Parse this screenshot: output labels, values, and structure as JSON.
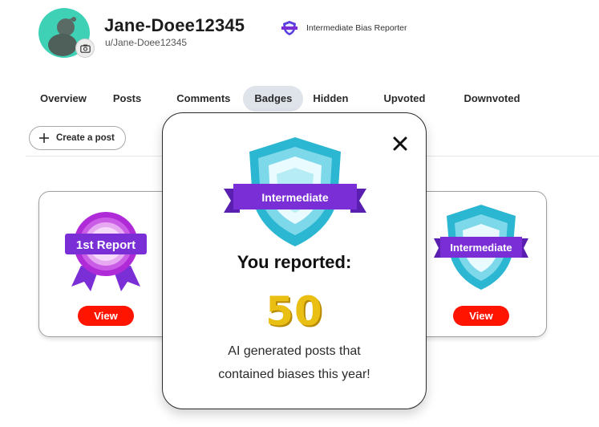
{
  "profile": {
    "username": "Jane-Doee12345",
    "handle": "u/Jane-Doee12345",
    "avatar_icon": "snoo-avatar-icon",
    "edit_avatar_icon": "camera-icon",
    "rank_label": "Intermediate Bias Reporter",
    "rank_icon": "shield-badge-icon"
  },
  "tabs": [
    {
      "label": "Overview",
      "active": false
    },
    {
      "label": "Posts",
      "active": false
    },
    {
      "label": "Comments",
      "active": false
    },
    {
      "label": "Badges",
      "active": true
    },
    {
      "label": "Hidden",
      "active": false
    },
    {
      "label": "Upvoted",
      "active": false
    },
    {
      "label": "Downvoted",
      "active": false
    }
  ],
  "create_post": {
    "label": "Create a post",
    "icon": "plus-icon"
  },
  "badges": [
    {
      "name": "1st Report",
      "button_label": "View"
    },
    {
      "name": "Intermediate",
      "button_label": "View"
    }
  ],
  "modal": {
    "badge_label": "Intermediate",
    "heading": "You reported:",
    "count": "50",
    "description_line1": "AI generated posts that",
    "description_line2": "contained biases this year!",
    "close_icon": "close-icon"
  },
  "colors": {
    "accent_red": "#ff1400",
    "badge_purple": "#7a2fd6",
    "badge_teal": "#35c7d6",
    "count_gold": "#e9bf13",
    "avatar_teal": "#3ed1b5",
    "active_tab_bg": "#dfe3ea"
  }
}
